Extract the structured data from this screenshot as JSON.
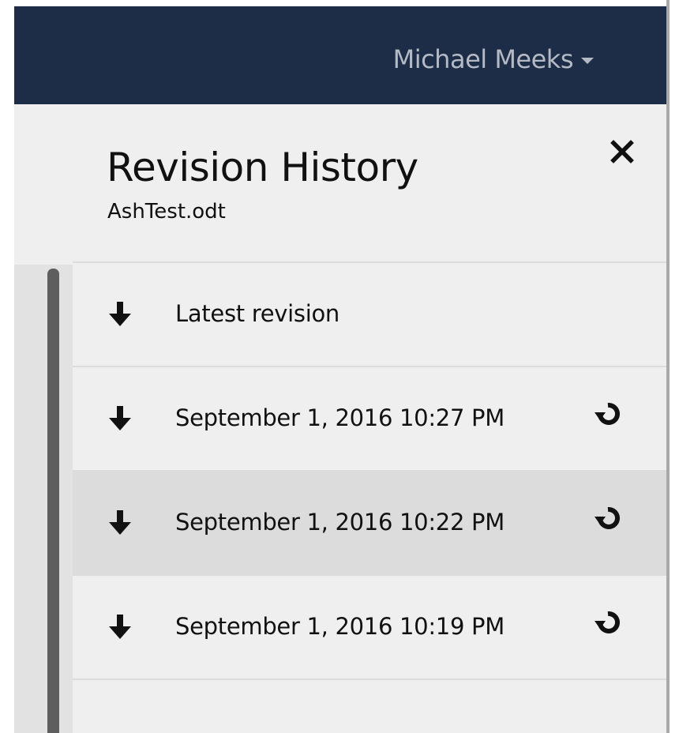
{
  "header": {
    "user_name": "Michael Meeks"
  },
  "panel": {
    "title": "Revision History",
    "filename": "AshTest.odt"
  },
  "revisions": [
    {
      "label": "Latest revision",
      "restorable": false,
      "selected": false
    },
    {
      "label": "September 1, 2016 10:27 PM",
      "restorable": true,
      "selected": false
    },
    {
      "label": "September 1, 2016 10:22 PM",
      "restorable": true,
      "selected": true
    },
    {
      "label": "September 1, 2016 10:19 PM",
      "restorable": true,
      "selected": false
    }
  ],
  "icons": {
    "user_menu": "chevron-down-icon",
    "close": "close-icon",
    "download": "download-arrow-icon",
    "restore": "restore-icon"
  },
  "colors": {
    "topbar": "#1e2d47",
    "topbar_text": "#b4bac5",
    "panel_bg": "#efefef",
    "selected_row": "#dcdcdc"
  }
}
